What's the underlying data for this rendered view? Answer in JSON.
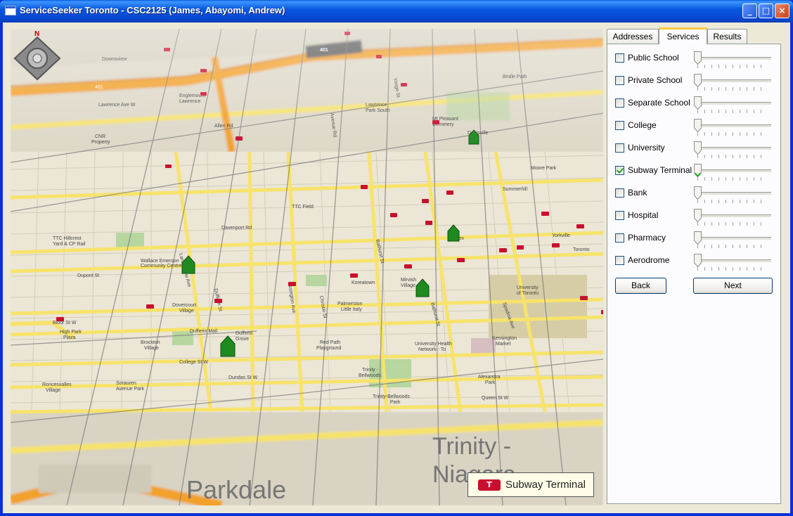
{
  "window": {
    "title": "ServiceSeeker Toronto - CSC2125 (James, Abayomi, Andrew)",
    "minimize_glyph": "_",
    "maximize_glyph": "□",
    "close_glyph": "×"
  },
  "map": {
    "compass_label": "N",
    "legend_label": "Subway Terminal",
    "legend_icon": "ttc-subway-icon",
    "labels": [
      "Downsview",
      "401",
      "Lawrence Ave W",
      "Englemount Lawrence",
      "CNR Property",
      "Allen Rd",
      "Lawrence Park South",
      "Mt Pleasant Cemetery",
      "Davisville",
      "Bridle Path",
      "Moore Park",
      "Summerhill",
      "TTC Field",
      "TTC Hillcrest Yard & CP Rail",
      "Wallace Emerson Community Centre",
      "Dupont St",
      "Davenport Rd",
      "Bloor St W",
      "Dovercourt Village",
      "Dufferin Mall",
      "Dufferin Grove",
      "Brockton Village",
      "Sorauren Avenue Park",
      "Roncesvalles Village",
      "High Park Plaza",
      "College St",
      "Palmerston Little Italy",
      "Koreatown",
      "Mirvish Village",
      "Annex",
      "University of Toronto",
      "Yorkville",
      "Toronto",
      "Red Path Playground",
      "University Health Network - To",
      "Trinity - Bellwoods",
      "Trinity-Bellwoods Park",
      "Kensington Market",
      "Alexandra Park",
      "Dundas St W",
      "Queen St W",
      "Parkdale",
      "Trinity - Niagara",
      "Bathurst St",
      "Ossington Ave",
      "Christie St",
      "Dufferin St",
      "Spadina Ave",
      "Yonge St",
      "Avenue Rd"
    ],
    "service_markers_color": "#1f8a1f",
    "subway_marker_color": "#c8102e"
  },
  "panel": {
    "tabs": [
      {
        "label": "Addresses",
        "active": false
      },
      {
        "label": "Services",
        "active": true
      },
      {
        "label": "Results",
        "active": false
      }
    ],
    "services": [
      {
        "label": "Public School",
        "checked": false,
        "level": 0
      },
      {
        "label": "Private School",
        "checked": false,
        "level": 0
      },
      {
        "label": "Separate School",
        "checked": false,
        "level": 0
      },
      {
        "label": "College",
        "checked": false,
        "level": 0
      },
      {
        "label": "University",
        "checked": false,
        "level": 0
      },
      {
        "label": "Subway Terminal",
        "checked": true,
        "level": 0
      },
      {
        "label": "Bank",
        "checked": false,
        "level": 0
      },
      {
        "label": "Hospital",
        "checked": false,
        "level": 0
      },
      {
        "label": "Pharmacy",
        "checked": false,
        "level": 0
      },
      {
        "label": "Aerodrome",
        "checked": false,
        "level": 0
      }
    ],
    "back_label": "Back",
    "next_label": "Next"
  },
  "colors": {
    "titlebar": "#0a58e0",
    "major_road": "#f7e36b",
    "highway": "#f2a12a",
    "park": "#b7d6a0",
    "tab_highlight": "#ffc83c"
  }
}
